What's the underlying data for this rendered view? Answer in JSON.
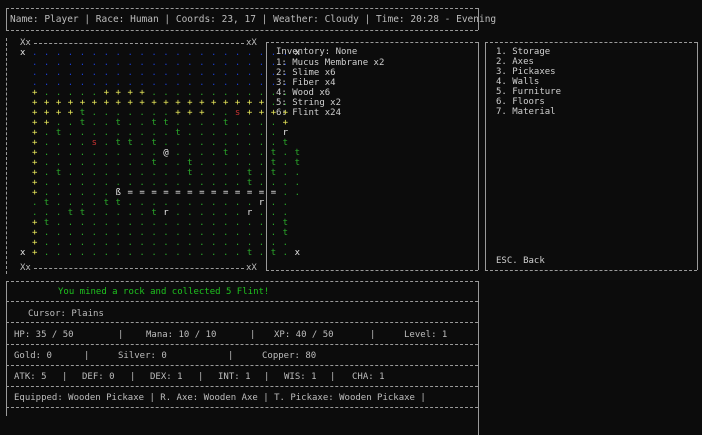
{
  "status": {
    "name_label": "Name: Player | Race: Human | Coords: 23, 17 | Weather: Cloudy | Time: 20:28 - Evening"
  },
  "inventory": {
    "header": "Inventory: None",
    "items": [
      "1: Mucus Membrane x2",
      "2: Slime x6",
      "3: Fiber x4",
      "4: Wood x6",
      "5: String x2",
      "6: Flint x24"
    ]
  },
  "craft_menu": {
    "items": [
      "1. Storage",
      "2. Axes",
      "3. Pickaxes",
      "4. Walls",
      "5. Furniture",
      "6. Floors",
      "7. Material"
    ],
    "back": "ESC. Back"
  },
  "message": "You mined a rock and collected 5 Flint!",
  "cursor": "Cursor: Plains",
  "stats": {
    "hp": "HP: 35 / 50",
    "mana": "Mana: 10 / 10",
    "xp": "XP: 40 / 50",
    "level": "Level: 1"
  },
  "money": {
    "gold": "Gold: 0",
    "silver": "Silver: 0",
    "copper": "Copper: 80"
  },
  "attributes": {
    "atk": "ATK: 5",
    "def": "DEF: 0",
    "dex": "DEX: 1",
    "int": "INT: 1",
    "wis": "WIS: 1",
    "cha": "CHA: 1"
  },
  "equipped": "Equipped: Wooden Pickaxe | R. Axe: Wooden Axe | T. Pickaxe: Wooden Pickaxe |",
  "map": {
    "corner_top_left": "Xx",
    "corner_top_right": "xX",
    "corner_bottom_left": "Xx",
    "corner_bottom_right": "xX",
    "player_glyph": "@",
    "rows": [
      "x . . . . . . . . . . . . . . . . . . . . . . x",
      "  . . . . . . . . . . . . . . . . . . . . . .  ",
      "  . . . . . . . . . . . . . . . . . . . . . .  ",
      "  . . . . . . . . . . . . . . . . . . . . . .  ",
      "  + . . . . . + + + + . . . . . . . . . . . .  ",
      "  + + + + + + + + + + + + + + + + + + + + . .  ",
      "  + + + + t . . . . . . . + + + . . s + + + +  ",
      "  + + . . t . . t . . t t . . . . t . . . . +  ",
      "  + . t . . . . . . . . . t . . . . . . . . r  ",
      "  + . . . . s . t t . t . . . . . . . . . . t  ",
      "  + . . . . . . . . . . @ . . . . t . . . t . t",
      "  + . . . . . . . . . t . . t . . . . . . t . t",
      "  + . t . . . . . . . . . . t . . . . t . t . .",
      "  + . . . . . . . . . . . . . . . . . t . . . .",
      "  + . . . . . . ß = = = = = = = = = = = = = . .",
      "  . t . . . . t t . . . . . . . . . . . r . .  ",
      "  . . . t t . . . . . t r . . . . . . r . . .  ",
      "  + t . . . . . . . . . . . . . . . . . . . t  ",
      "  + . . . . . . . . . . . . . . . . . . . . t  ",
      "  + . . . . . . . . . . . . . . . . . . . . .  ",
      "x + . . . . . . . . . . . . . . . . . t . t . x"
    ]
  }
}
